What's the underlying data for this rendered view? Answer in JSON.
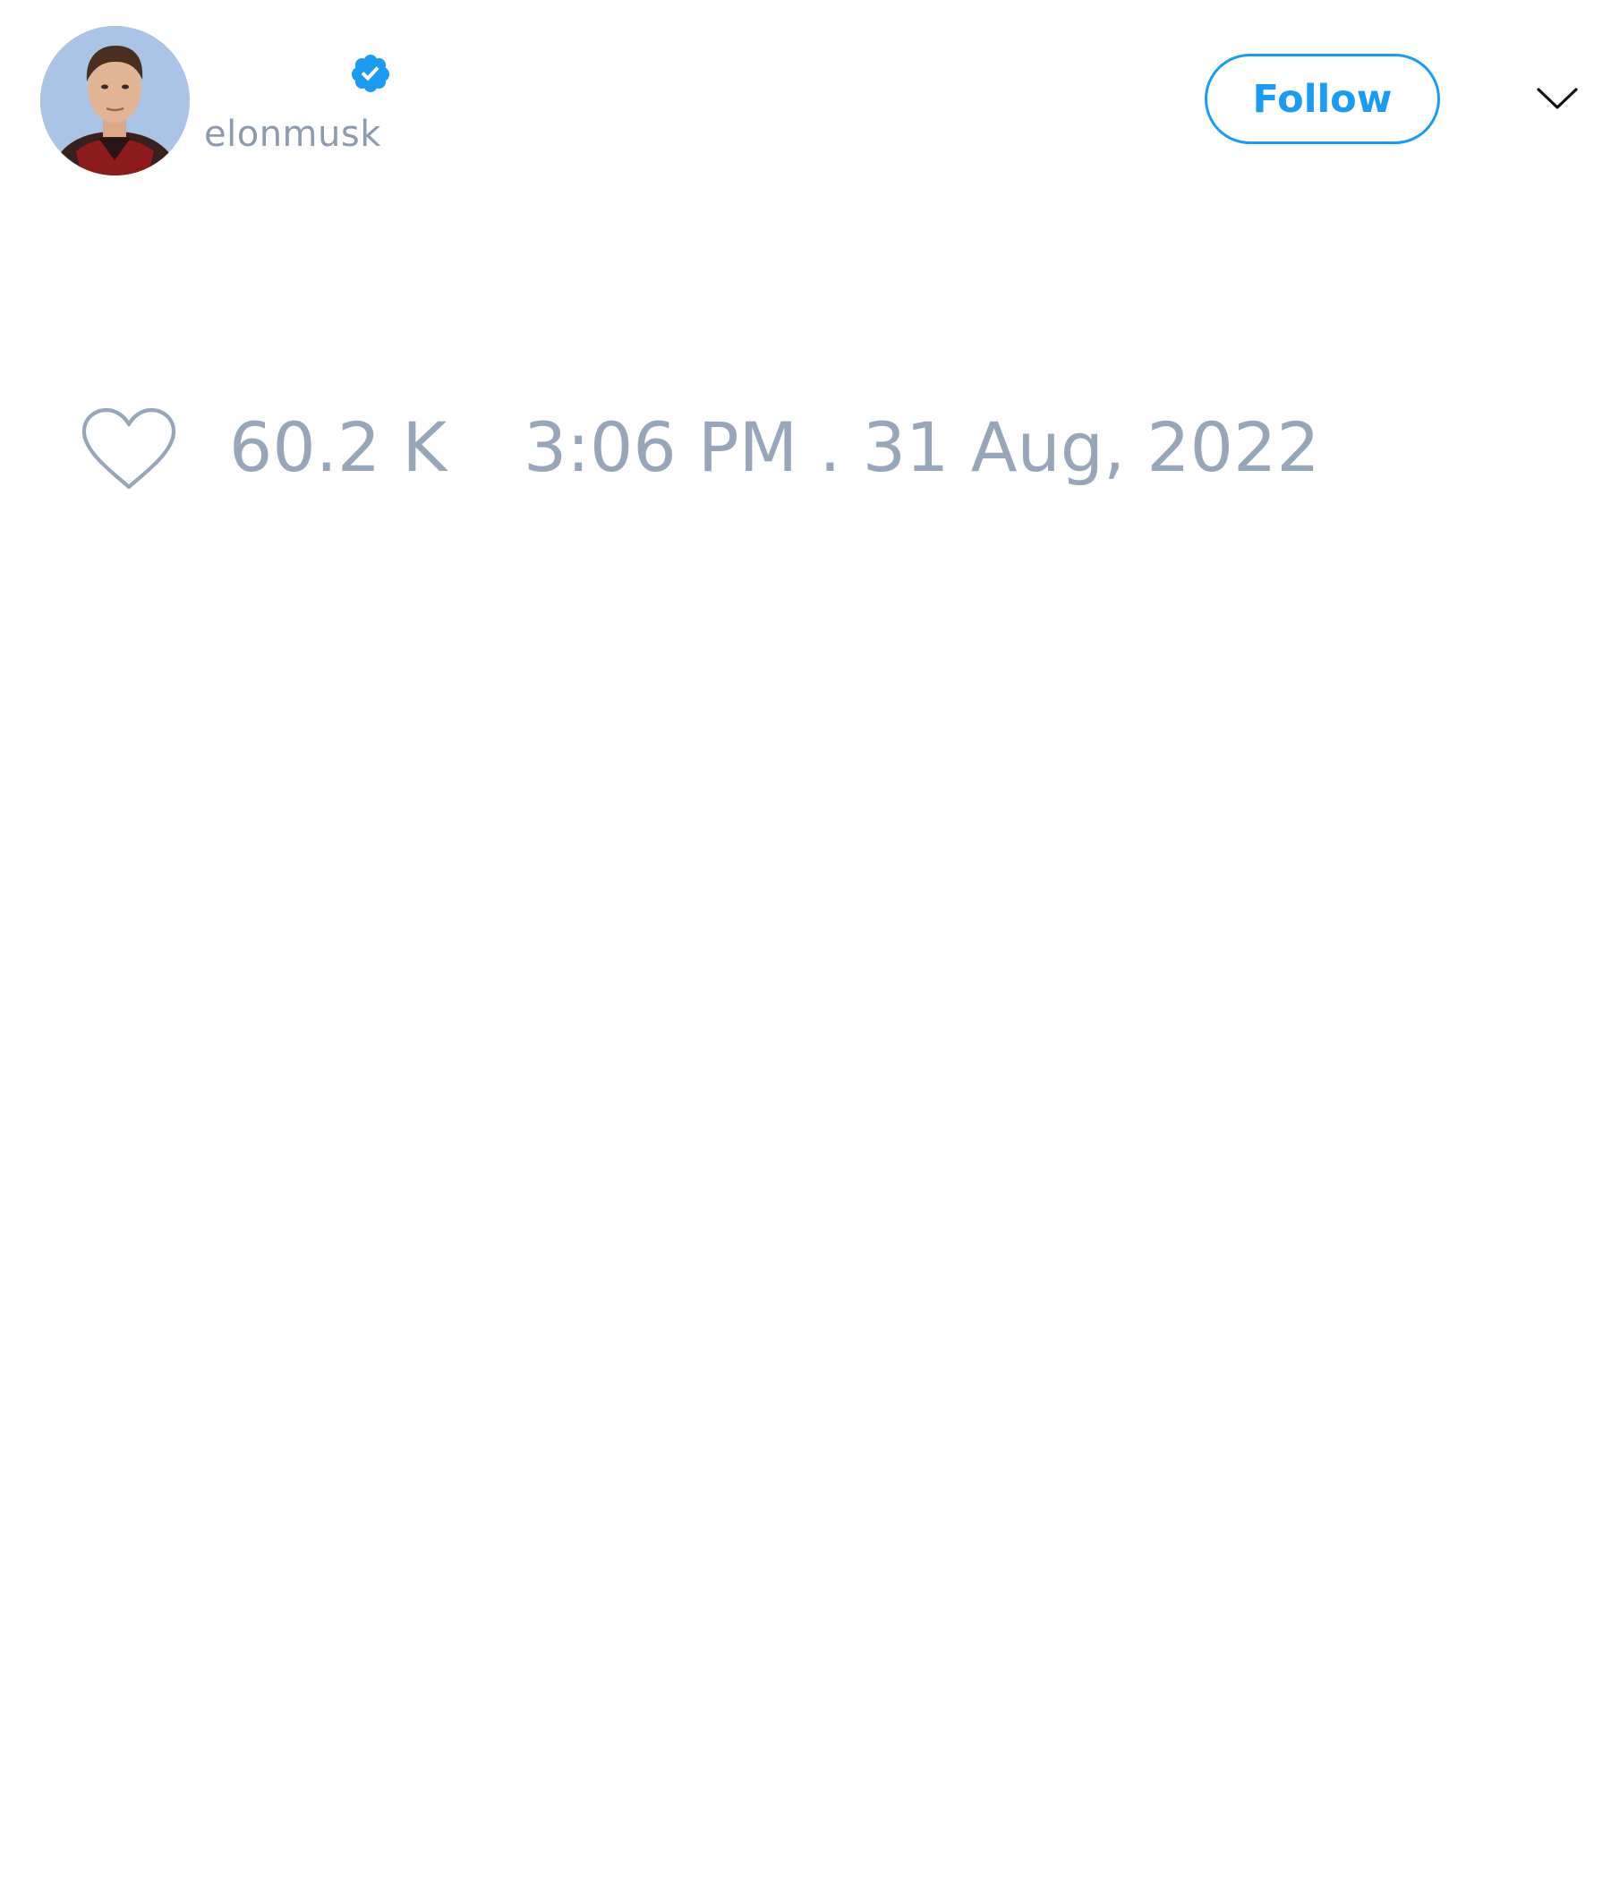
{
  "tweet": {
    "author": {
      "handle": "elonmusk",
      "avatar_icon": "profile-photo",
      "verified_icon": "verified-badge-icon"
    },
    "actions": {
      "follow_label": "Follow",
      "more_icon": "chevron-down-icon"
    },
    "footer": {
      "like_icon": "heart-icon",
      "like_count": "60.2 K",
      "timestamp": "3:06 PM . 31 Aug, 2022"
    }
  },
  "colors": {
    "accent": "#1d9bf0",
    "muted_text": "#98a6b9",
    "background": "#ffffff"
  }
}
